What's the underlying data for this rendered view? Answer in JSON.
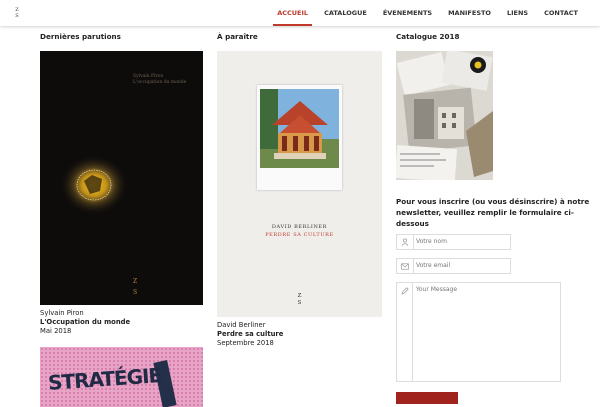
{
  "header": {
    "logo": [
      "Z",
      "S"
    ],
    "nav": [
      {
        "label": "ACCUEIL",
        "active": true
      },
      {
        "label": "CATALOGUE",
        "active": false
      },
      {
        "label": "ÉVENEMENTS",
        "active": false
      },
      {
        "label": "MANIFESTO",
        "active": false
      },
      {
        "label": "LIENS",
        "active": false
      },
      {
        "label": "CONTACT",
        "active": false
      }
    ]
  },
  "columns": {
    "recent": {
      "title": "Dernières parutions",
      "book": {
        "author": "Sylvain Piron",
        "title": "L'Occupation du monde",
        "date": "Mai 2018",
        "cover_author": "Sylvain Piron",
        "cover_title": "L'occupation du monde"
      },
      "second_cover_text": "STRATÉGIE"
    },
    "upcoming": {
      "title": "À paraître",
      "book": {
        "author": "David Berliner",
        "title": "Perdre sa culture",
        "date": "Septembre 2018",
        "cover_author": "DAVID BERLINER",
        "cover_title": "PERDRE SA CULTURE"
      }
    },
    "catalogue": {
      "title": "Catalogue 2018",
      "newsletter_text": "Pour vous inscrire (ou vous désinscrire) à notre newsletter, veuillez remplir le formulaire ci-dessous",
      "form": {
        "name_placeholder": "Votre nom",
        "email_placeholder": "Votre email",
        "message_placeholder": "Your Message"
      }
    }
  },
  "colors": {
    "accent": "#c0392b",
    "button": "#a0231e"
  }
}
